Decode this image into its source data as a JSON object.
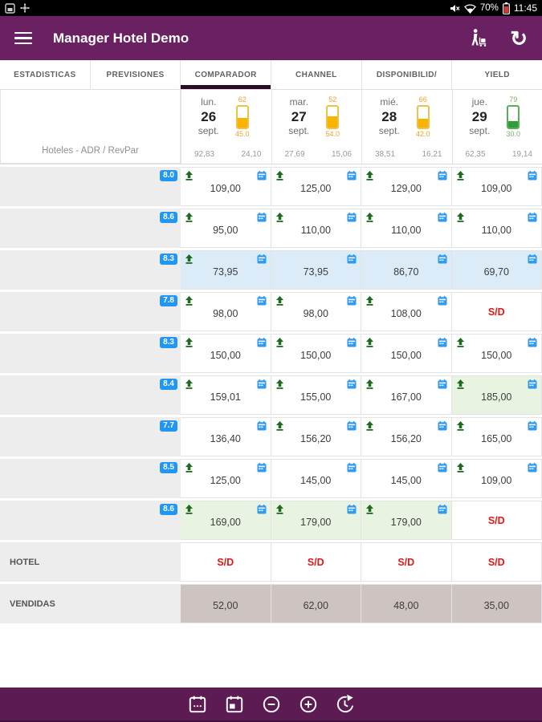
{
  "colors": {
    "app_bar_purple": "#6a2162",
    "bottom_bar_purple": "#5c1b53",
    "active_tab_underline": "#2c0b28",
    "badge_blue": "#2196f3",
    "calendar_icon_blue": "#2e9bf0",
    "upload_icon_green": "#1c6b1c",
    "alert_red": "#e21818",
    "gauge_yellow_outline": "#f0c04a",
    "gauge_yellow_fill": "#f7b500",
    "gauge_yellow_text": "#f0a32e",
    "gauge_green_outline": "#55b258",
    "gauge_green_fill": "#2f9e39",
    "gauge_green_text": "#7fae72"
  },
  "status_bar": {
    "time": "11:45",
    "battery_label": "70%",
    "left_icons": [
      "screenshot-icon",
      "settings-icon"
    ],
    "right_icons": [
      "mute-icon",
      "wifi-question-icon",
      "battery-icon"
    ]
  },
  "app_bar": {
    "title": "Manager Hotel Demo",
    "icons": [
      "menu-icon",
      "traveler-icon",
      "sync-icon"
    ],
    "sync_glyph": "↻"
  },
  "tabs": [
    {
      "label": "ESTADISTICAS",
      "active": false
    },
    {
      "label": "PREVISIONES",
      "active": false
    },
    {
      "label": "COMPARADOR",
      "active": true
    },
    {
      "label": "CHANNEL",
      "active": false
    },
    {
      "label": "DISPONIBILID/",
      "active": false
    },
    {
      "label": "YIELD",
      "active": false
    }
  ],
  "table": {
    "corner_label": "Hoteles - ADR / RevPar",
    "days": [
      {
        "dow": "lun.",
        "day": "26",
        "month": "sept.",
        "occupancy": "62",
        "gauge_value": "45.0",
        "gauge_fill_pct": 45,
        "gauge_color": "yellow",
        "adr": "92,83",
        "revpar": "24,10"
      },
      {
        "dow": "mar.",
        "day": "27",
        "month": "sept.",
        "occupancy": "52",
        "gauge_value": "54.0",
        "gauge_fill_pct": 54,
        "gauge_color": "yellow",
        "adr": "27,69",
        "revpar": "15,06"
      },
      {
        "dow": "mié.",
        "day": "28",
        "month": "sept.",
        "occupancy": "66",
        "gauge_value": "42.0",
        "gauge_fill_pct": 42,
        "gauge_color": "yellow",
        "adr": "38,51",
        "revpar": "16,21"
      },
      {
        "dow": "jue.",
        "day": "29",
        "month": "sept.",
        "occupancy": "79",
        "gauge_value": "30.0",
        "gauge_fill_pct": 30,
        "gauge_color": "green",
        "adr": "62,35",
        "revpar": "19,14"
      }
    ],
    "rows": [
      {
        "score": "8.0",
        "cells": [
          {
            "value": "109,00",
            "upload": true,
            "calendar": true,
            "bg": "white",
            "alert": false
          },
          {
            "value": "125,00",
            "upload": true,
            "calendar": true,
            "bg": "white",
            "alert": false
          },
          {
            "value": "129,00",
            "upload": true,
            "calendar": true,
            "bg": "white",
            "alert": false
          },
          {
            "value": "109,00",
            "upload": true,
            "calendar": true,
            "bg": "white",
            "alert": false
          }
        ]
      },
      {
        "score": "8.6",
        "cells": [
          {
            "value": "95,00",
            "upload": true,
            "calendar": true,
            "bg": "white",
            "alert": false
          },
          {
            "value": "110,00",
            "upload": true,
            "calendar": true,
            "bg": "white",
            "alert": false
          },
          {
            "value": "110,00",
            "upload": true,
            "calendar": true,
            "bg": "white",
            "alert": false
          },
          {
            "value": "110,00",
            "upload": true,
            "calendar": true,
            "bg": "white",
            "alert": false
          }
        ]
      },
      {
        "score": "8.3",
        "cells": [
          {
            "value": "73,95",
            "upload": true,
            "calendar": true,
            "bg": "blue",
            "alert": false
          },
          {
            "value": "73,95",
            "upload": false,
            "calendar": true,
            "bg": "blue",
            "alert": false
          },
          {
            "value": "86,70",
            "upload": false,
            "calendar": true,
            "bg": "blue",
            "alert": false
          },
          {
            "value": "69,70",
            "upload": false,
            "calendar": true,
            "bg": "blue",
            "alert": false
          }
        ]
      },
      {
        "score": "7.8",
        "cells": [
          {
            "value": "98,00",
            "upload": true,
            "calendar": true,
            "bg": "white",
            "alert": false
          },
          {
            "value": "98,00",
            "upload": true,
            "calendar": true,
            "bg": "white",
            "alert": false
          },
          {
            "value": "108,00",
            "upload": true,
            "calendar": true,
            "bg": "white",
            "alert": false
          },
          {
            "value": "S/D",
            "upload": false,
            "calendar": false,
            "bg": "white",
            "alert": true
          }
        ]
      },
      {
        "score": "8.3",
        "cells": [
          {
            "value": "150,00",
            "upload": true,
            "calendar": true,
            "bg": "white",
            "alert": false
          },
          {
            "value": "150,00",
            "upload": true,
            "calendar": true,
            "bg": "white",
            "alert": false
          },
          {
            "value": "150,00",
            "upload": true,
            "calendar": true,
            "bg": "white",
            "alert": false
          },
          {
            "value": "150,00",
            "upload": true,
            "calendar": true,
            "bg": "white",
            "alert": false
          }
        ]
      },
      {
        "score": "8.4",
        "cells": [
          {
            "value": "159,01",
            "upload": true,
            "calendar": true,
            "bg": "white",
            "alert": false
          },
          {
            "value": "155,00",
            "upload": true,
            "calendar": true,
            "bg": "white",
            "alert": false
          },
          {
            "value": "167,00",
            "upload": true,
            "calendar": true,
            "bg": "white",
            "alert": false
          },
          {
            "value": "185,00",
            "upload": true,
            "calendar": true,
            "bg": "green",
            "alert": false
          }
        ]
      },
      {
        "score": "7.7",
        "cells": [
          {
            "value": "136,40",
            "upload": false,
            "calendar": true,
            "bg": "white",
            "alert": false
          },
          {
            "value": "156,20",
            "upload": true,
            "calendar": true,
            "bg": "white",
            "alert": false
          },
          {
            "value": "156,20",
            "upload": true,
            "calendar": true,
            "bg": "white",
            "alert": false
          },
          {
            "value": "165,00",
            "upload": true,
            "calendar": true,
            "bg": "white",
            "alert": false
          }
        ]
      },
      {
        "score": "8.5",
        "cells": [
          {
            "value": "125,00",
            "upload": true,
            "calendar": true,
            "bg": "white",
            "alert": false
          },
          {
            "value": "145,00",
            "upload": false,
            "calendar": true,
            "bg": "white",
            "alert": false
          },
          {
            "value": "145,00",
            "upload": false,
            "calendar": true,
            "bg": "white",
            "alert": false
          },
          {
            "value": "109,00",
            "upload": true,
            "calendar": true,
            "bg": "white",
            "alert": false
          }
        ]
      },
      {
        "score": "8.6",
        "cells": [
          {
            "value": "169,00",
            "upload": true,
            "calendar": true,
            "bg": "green",
            "alert": false
          },
          {
            "value": "179,00",
            "upload": true,
            "calendar": true,
            "bg": "green",
            "alert": false
          },
          {
            "value": "179,00",
            "upload": true,
            "calendar": true,
            "bg": "green",
            "alert": false
          },
          {
            "value": "S/D",
            "upload": false,
            "calendar": false,
            "bg": "white",
            "alert": true
          }
        ]
      }
    ],
    "summary_rows": [
      {
        "label": "HOTEL",
        "cells": [
          {
            "value": "S/D",
            "bg": "white",
            "alert": true
          },
          {
            "value": "S/D",
            "bg": "white",
            "alert": true
          },
          {
            "value": "S/D",
            "bg": "white",
            "alert": true
          },
          {
            "value": "S/D",
            "bg": "white",
            "alert": true
          }
        ]
      },
      {
        "label": "VENDIDAS",
        "cells": [
          {
            "value": "52,00",
            "bg": "taupe",
            "alert": false
          },
          {
            "value": "62,00",
            "bg": "taupe",
            "alert": false
          },
          {
            "value": "48,00",
            "bg": "taupe",
            "alert": false
          },
          {
            "value": "35,00",
            "bg": "taupe",
            "alert": false
          }
        ]
      }
    ]
  },
  "bottom_bar": {
    "icons": [
      "calendar-range-icon",
      "calendar-day-icon",
      "zoom-out-icon",
      "zoom-in-icon",
      "refresh-time-icon"
    ]
  }
}
